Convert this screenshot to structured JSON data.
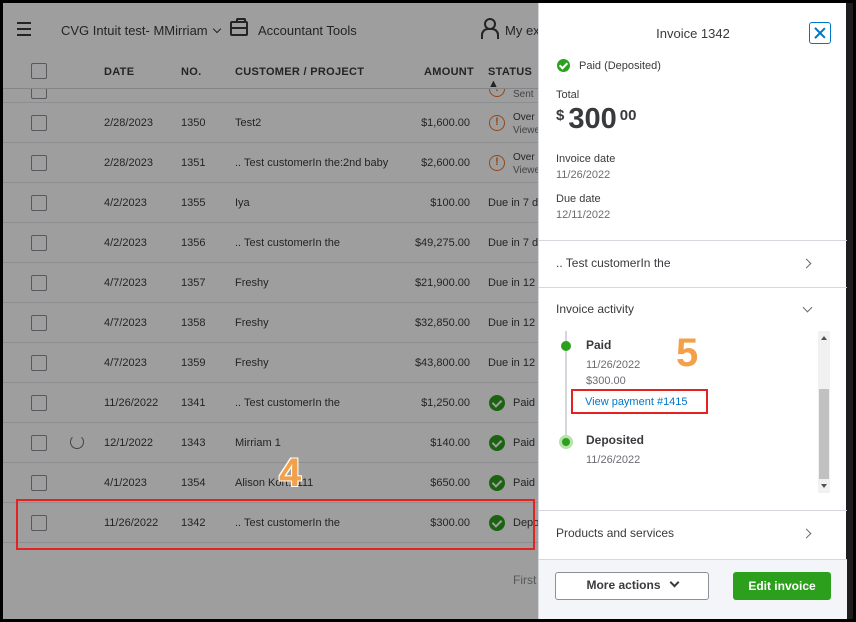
{
  "topbar": {
    "company": "CVG Intuit test- MMirriam",
    "accountant_tools": "Accountant Tools",
    "my_experts": "My ex"
  },
  "table": {
    "headers": [
      "DATE",
      "NO.",
      "CUSTOMER / PROJECT",
      "AMOUNT",
      "STATUS ▲"
    ],
    "top_partial_status": "Sent",
    "rows": [
      {
        "date": "2/28/2023",
        "no": "1350",
        "customer": "Test2",
        "amount": "$1,600.00",
        "status": "Over",
        "status_sub": "Viewe",
        "icon": "warn"
      },
      {
        "date": "2/28/2023",
        "no": "1351",
        "customer": ".. Test customerIn the:2nd baby",
        "amount": "$2,600.00",
        "status": "Over",
        "status_sub": "Viewe",
        "icon": "warn"
      },
      {
        "date": "4/2/2023",
        "no": "1355",
        "customer": "Iya",
        "amount": "$100.00",
        "status": "Due in 7 d",
        "status_sub": "",
        "icon": "none"
      },
      {
        "date": "4/2/2023",
        "no": "1356",
        "customer": ".. Test customerIn the",
        "amount": "$49,275.00",
        "status": "Due in 7 d",
        "status_sub": "",
        "icon": "none"
      },
      {
        "date": "4/7/2023",
        "no": "1357",
        "customer": "Freshy",
        "amount": "$21,900.00",
        "status": "Due in 12 d",
        "status_sub": "",
        "icon": "none"
      },
      {
        "date": "4/7/2023",
        "no": "1358",
        "customer": "Freshy",
        "amount": "$32,850.00",
        "status": "Due in 12 d",
        "status_sub": "",
        "icon": "none"
      },
      {
        "date": "4/7/2023",
        "no": "1359",
        "customer": "Freshy",
        "amount": "$43,800.00",
        "status": "Due in 12 d",
        "status_sub": "",
        "icon": "none"
      },
      {
        "date": "11/26/2022",
        "no": "1341",
        "customer": ".. Test customerIn the",
        "amount": "$1,250.00",
        "status": "Paid",
        "status_sub": "",
        "icon": "check"
      },
      {
        "date": "12/1/2022",
        "no": "1343",
        "customer": "Mirriam 1",
        "amount": "$140.00",
        "status": "Paid",
        "status_sub": "",
        "icon": "check"
      },
      {
        "date": "4/1/2023",
        "no": "1354",
        "customer": "Alison Kort:1111",
        "amount": "$650.00",
        "status": "Paid",
        "status_sub": "",
        "icon": "check"
      },
      {
        "date": "11/26/2022",
        "no": "1342",
        "customer": ".. Test customerIn the",
        "amount": "$300.00",
        "status": "Depo",
        "status_sub": "",
        "icon": "check"
      }
    ],
    "pagination_first": "First"
  },
  "annotations": {
    "step_4": "4",
    "step_5": "5"
  },
  "panel": {
    "title": "Invoice 1342",
    "status": "Paid (Deposited)",
    "total_label": "Total",
    "total_currency": "$",
    "total_main": "300",
    "total_cents": "00",
    "invoice_date_label": "Invoice date",
    "invoice_date": "11/26/2022",
    "due_date_label": "Due date",
    "due_date": "12/11/2022",
    "customer": ".. Test customerIn the",
    "activity_label": "Invoice activity",
    "activity": {
      "paid_title": "Paid",
      "paid_date": "11/26/2022",
      "paid_amount": "$300.00",
      "view_payment": "View payment #1415",
      "deposited_title": "Deposited",
      "deposited_date": "11/26/2022"
    },
    "products_label": "Products and services",
    "more_actions": "More actions",
    "edit_invoice": "Edit invoice"
  }
}
